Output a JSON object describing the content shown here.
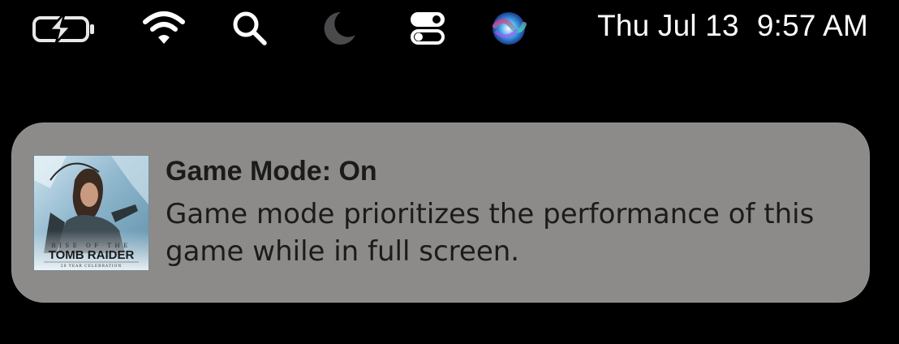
{
  "menubar": {
    "icons": [
      "battery-charging-icon",
      "wifi-icon",
      "search-icon",
      "focus-moon-icon",
      "control-center-icon",
      "siri-icon"
    ],
    "date": "Thu Jul 13",
    "time": "9:57 AM"
  },
  "notification": {
    "app_icon": {
      "name": "tomb-raider-app-icon",
      "logo_top": "RISE OF THE",
      "logo_main": "TOMB RAIDER",
      "logo_bottom": "20 YEAR CELEBRATION"
    },
    "title": "Game Mode: On",
    "body": "Game mode prioritizes the performance of this game while in full screen."
  },
  "colors": {
    "background": "#000000",
    "notification_bg": "#8c8b89",
    "text_dark": "#1b1b1b",
    "menubar_text": "#ffffff"
  }
}
